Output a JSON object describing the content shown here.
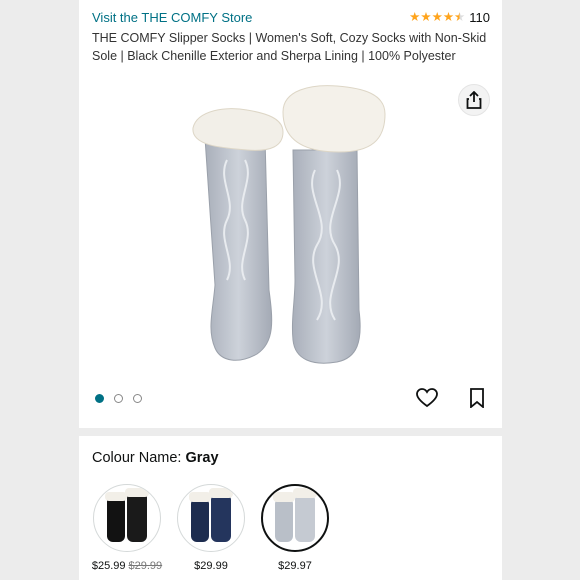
{
  "header": {
    "store_link": "Visit the THE COMFY Store",
    "rating_value": 4.5,
    "rating_count": "110",
    "title": "THE COMFY Slipper Socks | Women's Soft, Cozy Socks with Non-Skid Sole | Black Chenille Exterior and Sherpa Lining | 100% Polyester"
  },
  "gallery": {
    "image_count": 3,
    "active_index": 0,
    "share_icon": "share-icon",
    "wishlist_icon": "heart-icon",
    "save_icon": "bookmark-icon"
  },
  "colour": {
    "label": "Colour Name:",
    "selected": "Gray",
    "swatches": [
      {
        "color_name": "Black",
        "price": "$25.99",
        "old_price": "$29.99",
        "hex": "#121212"
      },
      {
        "color_name": "Navy",
        "price": "$29.99",
        "old_price": "",
        "hex": "#1d2c4f"
      },
      {
        "color_name": "Gray",
        "price": "$29.97",
        "old_price": "",
        "hex": "#b9bfc8"
      }
    ]
  },
  "colors": {
    "link": "#007185",
    "star": "#ffa41c",
    "background": "#ececec"
  }
}
